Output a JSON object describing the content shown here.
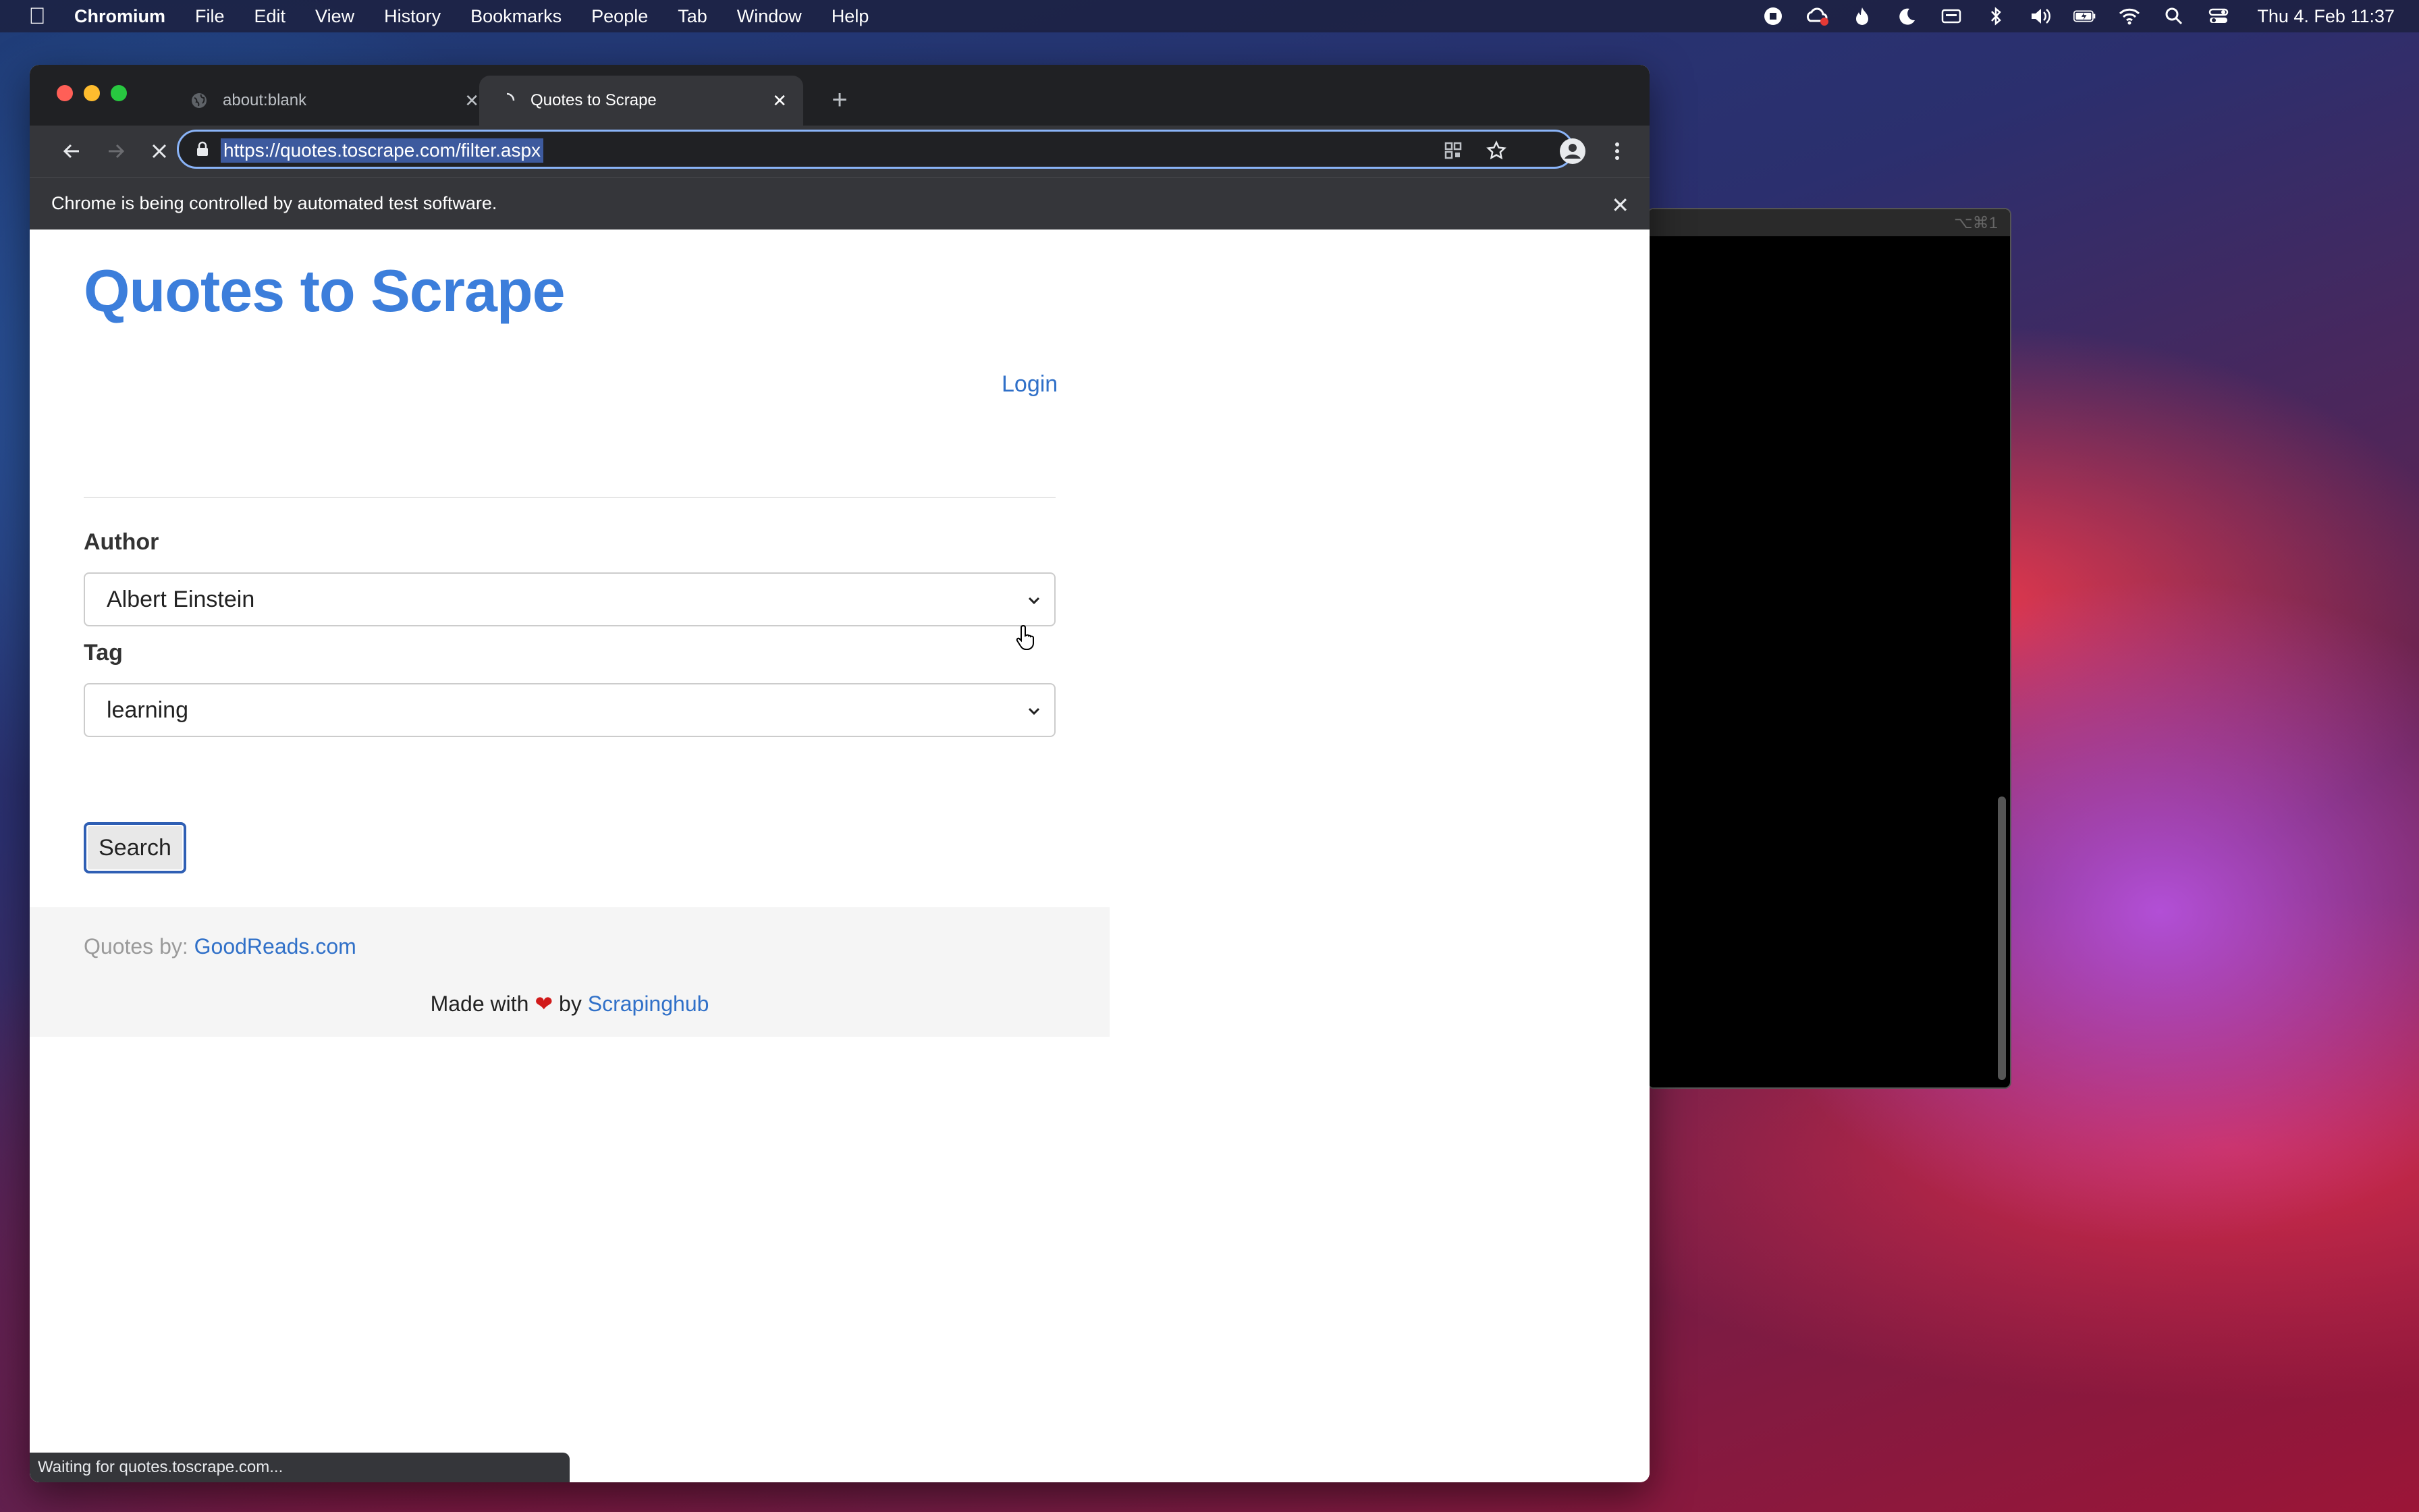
{
  "menubar": {
    "app": "Chromium",
    "items": [
      "File",
      "Edit",
      "View",
      "History",
      "Bookmarks",
      "People",
      "Tab",
      "Window",
      "Help"
    ],
    "clock": "Thu 4. Feb  11:37"
  },
  "terminal": {
    "shortcut": "⌥⌘1"
  },
  "browser": {
    "tabs": [
      {
        "title": "about:blank"
      },
      {
        "title": "Quotes to Scrape"
      }
    ],
    "url": "https://quotes.toscrape.com/filter.aspx",
    "infobar": "Chrome is being controlled by automated test software.",
    "status": "Waiting for quotes.toscrape.com..."
  },
  "page": {
    "site_title": "Quotes to Scrape",
    "login": "Login",
    "author_label": "Author",
    "author_value": "Albert Einstein",
    "tag_label": "Tag",
    "tag_value": "learning",
    "search_button": "Search",
    "footer": {
      "quotes_by": "Quotes by: ",
      "goodreads": "GoodReads.com",
      "made_with": "Made with ",
      "heart": "❤",
      "by": " by ",
      "scrapinghub": "Scrapinghub"
    }
  },
  "colors": {
    "title_blue": "#3c7edb",
    "link_blue": "#3070c8",
    "chrome_dark": "#35363a"
  }
}
